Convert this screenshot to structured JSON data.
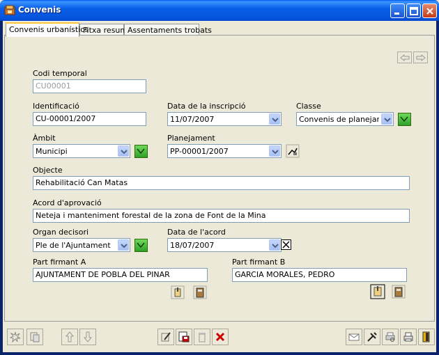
{
  "window": {
    "title": "Convenis"
  },
  "tabs": [
    {
      "label": "Convenis urbanístics"
    },
    {
      "label": "Fitxa resum"
    },
    {
      "label": "Assentaments trobats"
    }
  ],
  "form": {
    "codi_temporal": {
      "label": "Codi temporal",
      "value": "CU00001"
    },
    "identificacio": {
      "label": "Identificació",
      "value": "CU-00001/2007"
    },
    "data_inscripcio": {
      "label": "Data de la inscripció",
      "value": "11/07/2007"
    },
    "classe": {
      "label": "Classe",
      "value": "Convenis  de planejamen"
    },
    "ambit": {
      "label": "Àmbit",
      "value": "Municipi"
    },
    "planejament": {
      "label": "Planejament",
      "value": "PP-00001/2007"
    },
    "objecte": {
      "label": "Objecte",
      "value": "Rehabilitació Can Matas"
    },
    "acord_aprovacio": {
      "label": "Acord d'aprovació",
      "value": "Neteja i manteniment forestal de la zona de Font de la Mina"
    },
    "organ_decisori": {
      "label": "Organ decisori",
      "value": "Ple de l'Ajuntament"
    },
    "data_acord": {
      "label": "Data de l'acord",
      "value": "18/07/2007"
    },
    "part_a": {
      "label": "Part firmant A",
      "value": "AJUNTAMENT DE POBLA DEL PINAR"
    },
    "part_b": {
      "label": "Part firmant B",
      "value": "GARCIA MORALES, PEDRO"
    }
  },
  "colors": {
    "titlebar": "#0a5fe6",
    "frame": "#ece9d8",
    "accept": "#2ea02a",
    "delete": "#cc0000"
  }
}
